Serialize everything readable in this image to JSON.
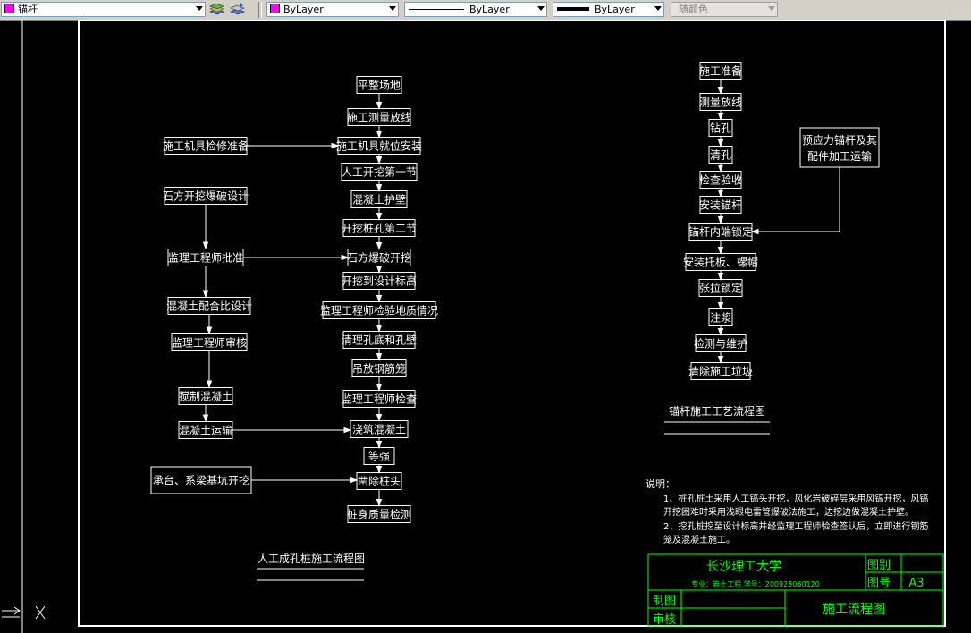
{
  "toolbar": {
    "layer_name": "锚杆",
    "color_value": "ByLayer",
    "linetype_value": "ByLayer",
    "lineweight_value": "ByLayer",
    "plotstyle_value": "随颜色",
    "layer_color": "#ff00ff"
  },
  "left_flow": {
    "title": "人工成孔桩施工流程图",
    "main_steps": [
      "平整场地",
      "施工测量放线",
      "施工机具就位安装",
      "人工开挖第一节",
      "混凝土护壁",
      "开挖桩孔第二节",
      "石方爆破开挖",
      "开挖到设计标高",
      "监理工程师检验地质情况",
      "清理孔底和孔壁",
      "吊放钢筋笼",
      "监理工程师检查",
      "浇筑混凝土",
      "等强",
      "凿除桩头",
      "桩身质量检测"
    ],
    "side_steps": [
      "施工机具检修准备",
      "石方开挖爆破设计",
      "监理工程师批准",
      "混凝土配合比设计",
      "监理工程师审核",
      "搅制混凝土",
      "混凝土运输",
      "承台、系梁基坑开挖"
    ]
  },
  "right_flow": {
    "title": "锚杆施工工艺流程图",
    "steps": [
      "施工准备",
      "测量放线",
      "钻孔",
      "清孔",
      "检查验收",
      "安装锚杆",
      "锚杆内端锁定",
      "安装托板、螺帽",
      "张拉锁定",
      "注浆",
      "检测与维护",
      "清除施工垃圾"
    ],
    "side_step": "预应力锚杆及其配件加工运输"
  },
  "notes": {
    "heading": "说明：",
    "lines": [
      "1、桩孔桩土采用人工镐头开挖，风化岩破碎层采用风镐开挖，风镐",
      "开挖困难时采用浅眼电雷管爆破法施工，边挖边做混凝土护壁。",
      "2、挖孔桩挖至设计标高并经监理工程师验查签认后，立即进行钢筋",
      "笼及混凝土施工。"
    ]
  },
  "title_block": {
    "school": "长沙理工大学",
    "major_line": "专业：岩土工程  学号：200925060120",
    "label_drawing_type": "图别",
    "label_drawing_no": "图号",
    "sheet_size": "A3",
    "label_drawn": "制图",
    "label_checked": "审核",
    "drawing_title": "施工流程图"
  },
  "colors": {
    "green": "#00ff00",
    "white": "#ffffff",
    "background": "#000000",
    "layer": "#ff00ff"
  }
}
